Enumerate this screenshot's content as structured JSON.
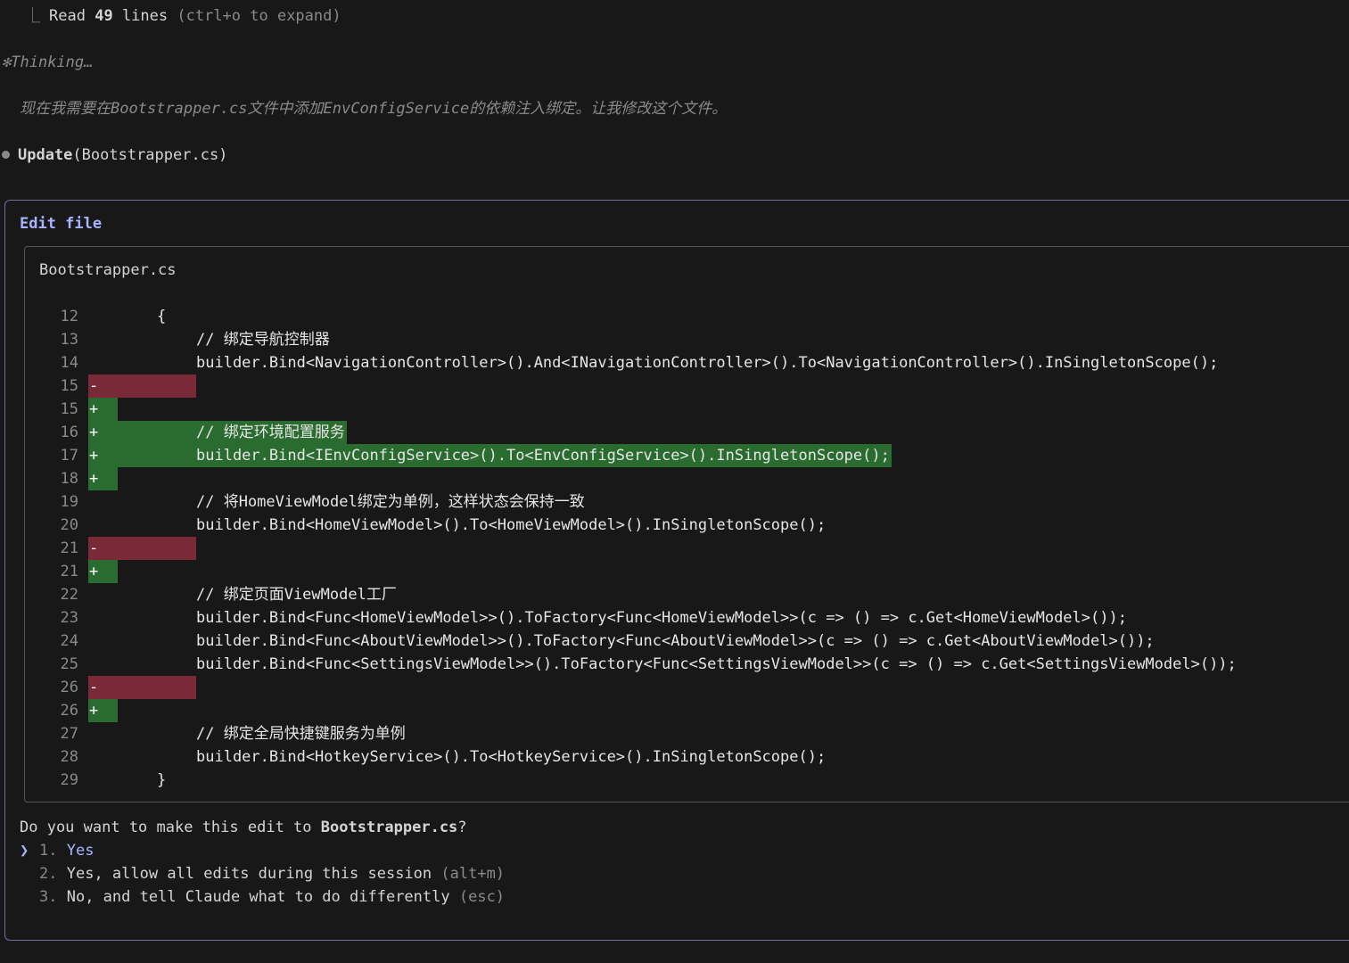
{
  "read_line": {
    "corner": "⎿",
    "text": "Read",
    "count": "49",
    "unit": "lines",
    "hint": "(ctrl+o to expand)"
  },
  "thinking": {
    "glyph": "✻",
    "label": "Thinking…"
  },
  "thought_text": "现在我需要在Bootstrapper.cs文件中添加EnvConfigService的依赖注入绑定。让我修改这个文件。",
  "update": {
    "tool": "Update",
    "arg": "(Bootstrapper.cs)"
  },
  "edit": {
    "title": "Edit file",
    "file_name": "Bootstrapper.cs",
    "lines": [
      {
        "num": "12",
        "type": "ctx",
        "indent": 1,
        "text": "{"
      },
      {
        "num": "13",
        "type": "ctx",
        "indent": 2,
        "text": "// 绑定导航控制器"
      },
      {
        "num": "14",
        "type": "ctx",
        "indent": 2,
        "text": "builder.Bind<NavigationController>().And<INavigationController>().To<NavigationController>().InSingletonScope();"
      },
      {
        "num": "15",
        "type": "rm",
        "sign": "-",
        "indent": 2,
        "text": ""
      },
      {
        "num": "15",
        "type": "add",
        "sign": "+",
        "indent": 2,
        "text": ""
      },
      {
        "num": "16",
        "type": "add",
        "sign": "+",
        "indent": 2,
        "text": "// 绑定环境配置服务"
      },
      {
        "num": "17",
        "type": "add",
        "sign": "+",
        "indent": 2,
        "text": "builder.Bind<IEnvConfigService>().To<EnvConfigService>().InSingletonScope();"
      },
      {
        "num": "18",
        "type": "add",
        "sign": "+",
        "indent": 2,
        "text": ""
      },
      {
        "num": "19",
        "type": "ctx",
        "indent": 2,
        "text": "// 将HomeViewModel绑定为单例，这样状态会保持一致"
      },
      {
        "num": "20",
        "type": "ctx",
        "indent": 2,
        "text": "builder.Bind<HomeViewModel>().To<HomeViewModel>().InSingletonScope();"
      },
      {
        "num": "21",
        "type": "rm",
        "sign": "-",
        "indent": 2,
        "text": ""
      },
      {
        "num": "21",
        "type": "add",
        "sign": "+",
        "indent": 2,
        "text": ""
      },
      {
        "num": "22",
        "type": "ctx",
        "indent": 2,
        "text": "// 绑定页面ViewModel工厂"
      },
      {
        "num": "23",
        "type": "ctx",
        "indent": 2,
        "text": "builder.Bind<Func<HomeViewModel>>().ToFactory<Func<HomeViewModel>>(c => () => c.Get<HomeViewModel>());"
      },
      {
        "num": "24",
        "type": "ctx",
        "indent": 2,
        "text": "builder.Bind<Func<AboutViewModel>>().ToFactory<Func<AboutViewModel>>(c => () => c.Get<AboutViewModel>());"
      },
      {
        "num": "25",
        "type": "ctx",
        "indent": 2,
        "text": "builder.Bind<Func<SettingsViewModel>>().ToFactory<Func<SettingsViewModel>>(c => () => c.Get<SettingsViewModel>());"
      },
      {
        "num": "26",
        "type": "rm",
        "sign": "-",
        "indent": 2,
        "text": ""
      },
      {
        "num": "26",
        "type": "add",
        "sign": "+",
        "indent": 2,
        "text": ""
      },
      {
        "num": "27",
        "type": "ctx",
        "indent": 2,
        "text": "// 绑定全局快捷键服务为单例"
      },
      {
        "num": "28",
        "type": "ctx",
        "indent": 2,
        "text": "builder.Bind<HotkeyService>().To<HotkeyService>().InSingletonScope();"
      },
      {
        "num": "29",
        "type": "ctx",
        "indent": 1,
        "text": "}"
      }
    ]
  },
  "prompt": {
    "question_prefix": "Do you want to make this edit to ",
    "question_file": "Bootstrapper.cs",
    "question_suffix": "?",
    "caret": "❯",
    "options": [
      {
        "num": "1.",
        "label": "Yes",
        "hint": "",
        "selected": true
      },
      {
        "num": "2.",
        "label": "Yes, allow all edits during this session",
        "hint": "(alt+m)",
        "selected": false
      },
      {
        "num": "3.",
        "label": "No, and tell Claude what to do differently",
        "hint": "(esc)",
        "selected": false
      }
    ]
  },
  "colors": {
    "removed_bg": "#7a2937",
    "added_bg": "#2a6b30",
    "accent": "#a8b4ff"
  }
}
